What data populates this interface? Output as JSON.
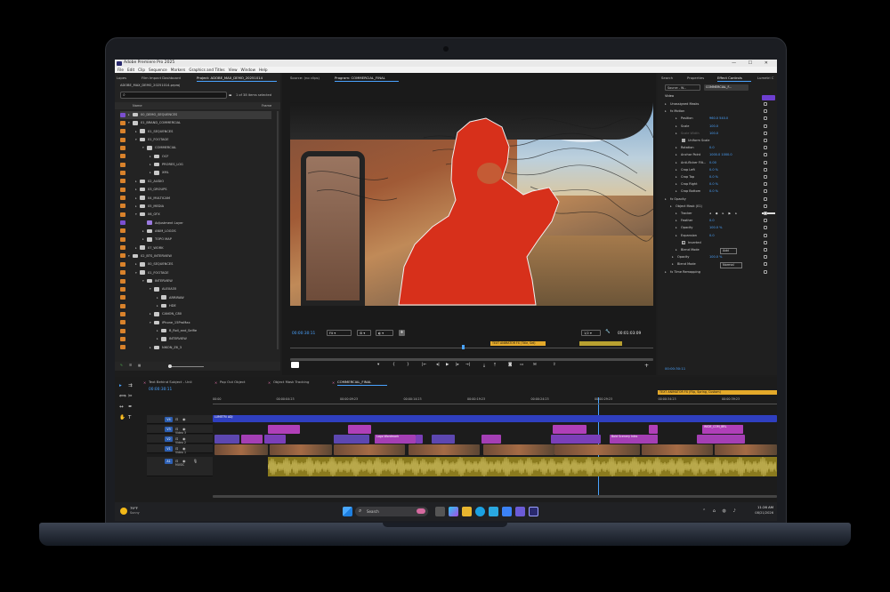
{
  "window": {
    "title": "Adobe Premiere Pro 2025",
    "menu": [
      "File",
      "Edit",
      "Clip",
      "Sequence",
      "Markers",
      "Graphics and Titles",
      "View",
      "Window",
      "Help"
    ]
  },
  "project_panel": {
    "tabs": [
      "Lopes",
      "Film Impact Dashboard",
      "Project: ADOBE_MAX_DEMO_20251014"
    ],
    "file": "ADOBE_MAX_DEMO_20251014.prproj",
    "count": "1 of 38 items selected",
    "col_name": "Name",
    "col_frame": "Frame",
    "items": [
      {
        "name": "00_DEMO_SEQUENCES",
        "depth": 0,
        "open": false,
        "color": "#7b4fd0",
        "type": "folder"
      },
      {
        "name": "01_BRAND_COMMERCIAL",
        "depth": 0,
        "open": true,
        "color": "#d9822b",
        "type": "folder"
      },
      {
        "name": "01_SEQUENCES",
        "depth": 1,
        "open": false,
        "color": "#d9822b",
        "type": "folder"
      },
      {
        "name": "01_FOOTAGE",
        "depth": 1,
        "open": true,
        "color": "#d9822b",
        "type": "folder"
      },
      {
        "name": "COMMERCIAL",
        "depth": 2,
        "open": true,
        "color": "#d9822b",
        "type": "folder"
      },
      {
        "name": "OCF",
        "depth": 3,
        "open": false,
        "color": "#d9822b",
        "type": "folder"
      },
      {
        "name": "PRORES_LOG",
        "depth": 3,
        "open": false,
        "color": "#d9822b",
        "type": "folder"
      },
      {
        "name": "XML",
        "depth": 3,
        "open": false,
        "color": "#d9822b",
        "type": "folder"
      },
      {
        "name": "02_AUDIO",
        "depth": 1,
        "open": false,
        "color": "#d9822b",
        "type": "folder"
      },
      {
        "name": "03_GROUPS",
        "depth": 1,
        "open": false,
        "color": "#d9822b",
        "type": "folder"
      },
      {
        "name": "04_MULTICAM",
        "depth": 1,
        "open": false,
        "color": "#d9822b",
        "type": "folder"
      },
      {
        "name": "05_MEDIA",
        "depth": 1,
        "open": false,
        "color": "#d9822b",
        "type": "folder"
      },
      {
        "name": "06_GFX",
        "depth": 1,
        "open": true,
        "color": "#d9822b",
        "type": "folder"
      },
      {
        "name": "Adjustment Layer",
        "depth": 2,
        "open": false,
        "color": "#7b4fd0",
        "type": "item"
      },
      {
        "name": "ANIM_LOGOS",
        "depth": 2,
        "open": false,
        "color": "#d9822b",
        "type": "folder"
      },
      {
        "name": "TOPO MAP",
        "depth": 2,
        "open": false,
        "color": "#d9822b",
        "type": "folder"
      },
      {
        "name": "07_WORK",
        "depth": 1,
        "open": false,
        "color": "#d9822b",
        "type": "folder"
      },
      {
        "name": "02_BTS_INTERVIEW",
        "depth": 0,
        "open": true,
        "color": "#d9822b",
        "type": "folder"
      },
      {
        "name": "00_SEQUENCES",
        "depth": 1,
        "open": false,
        "color": "#d9822b",
        "type": "folder"
      },
      {
        "name": "01_FOOTAGE",
        "depth": 1,
        "open": true,
        "color": "#d9822b",
        "type": "folder"
      },
      {
        "name": "INTERVIEW",
        "depth": 2,
        "open": true,
        "color": "#d9822b",
        "type": "folder"
      },
      {
        "name": "ALEXA35",
        "depth": 3,
        "open": true,
        "color": "#d9822b",
        "type": "folder"
      },
      {
        "name": "ARRIRAW",
        "depth": 4,
        "open": false,
        "color": "#d9822b",
        "type": "folder"
      },
      {
        "name": "HDE",
        "depth": 4,
        "open": false,
        "color": "#d9822b",
        "type": "folder"
      },
      {
        "name": "CANON_C80",
        "depth": 3,
        "open": false,
        "color": "#d9822b",
        "type": "folder"
      },
      {
        "name": "iPhone_15ProMax",
        "depth": 3,
        "open": true,
        "color": "#d9822b",
        "type": "folder"
      },
      {
        "name": "B_Roll_and_Selfie",
        "depth": 4,
        "open": false,
        "color": "#d9822b",
        "type": "folder"
      },
      {
        "name": "INTERVIEW",
        "depth": 4,
        "open": false,
        "color": "#d9822b",
        "type": "folder"
      },
      {
        "name": "NIKON_Z6_3",
        "depth": 3,
        "open": false,
        "color": "#d9822b",
        "type": "folder"
      }
    ]
  },
  "monitors": {
    "source_tab": "Source: (no clips)",
    "program_tab": "Program: COMMERCIAL_FINAL",
    "timecode_in": "00:00:30:11",
    "fit": "Fit",
    "fraction": "1/2",
    "timecode_out": "00:01:03:09",
    "marker_label": "TEXT ANIMATOR FX (Title, Set)"
  },
  "effect_controls": {
    "tabs": [
      "Search",
      "Properties",
      "Effect Controls",
      "Lumetri C"
    ],
    "source": "Source - W...",
    "clip": "COMMERCIAL_F...",
    "section": "Video",
    "rows": [
      {
        "label": "Unassigned Masks",
        "value": ""
      },
      {
        "label": "fx  Motion",
        "value": ""
      },
      {
        "label": "Position",
        "value": "960.0   540.0"
      },
      {
        "label": "Scale",
        "value": "100.0"
      },
      {
        "label": "Scale Width",
        "value": "100.0"
      },
      {
        "label": "Uniform Scale",
        "value": ""
      },
      {
        "label": "Rotation",
        "value": "0.0"
      },
      {
        "label": "Anchor Point",
        "value": "1000.0   1000.0"
      },
      {
        "label": "Anti-flicker Filt...",
        "value": "0.00"
      },
      {
        "label": "Crop Left",
        "value": "0.0 %"
      },
      {
        "label": "Crop Top",
        "value": "0.0 %"
      },
      {
        "label": "Crop Right",
        "value": "0.0 %"
      },
      {
        "label": "Crop Bottom",
        "value": "0.0 %"
      },
      {
        "label": "fx  Opacity",
        "value": ""
      },
      {
        "label": "Object Mask (01)",
        "value": ""
      },
      {
        "label": "Tracker",
        "value": ""
      },
      {
        "label": "Feather",
        "value": "0.0"
      },
      {
        "label": "Opacity",
        "value": "100.0 %"
      },
      {
        "label": "Expansion",
        "value": "0.0"
      },
      {
        "label": "Inverted",
        "value": ""
      },
      {
        "label": "Blend Mode",
        "value": "Add"
      },
      {
        "label": "Opacity",
        "value": "100.0 %"
      },
      {
        "label": "Blend Mode",
        "value": "Normal"
      },
      {
        "label": "fx  Time Remapping",
        "value": ""
      }
    ],
    "timecode": "00:00:30:11"
  },
  "timeline": {
    "tabs": [
      "Text Behind Subject - Unli",
      "Pop Out Object",
      "Object Mask Tracking",
      "COMMERCIAL_FINAL"
    ],
    "timecode": "00:00:30:11",
    "ruler": [
      "00:00",
      "00:00:04:23",
      "00:00:09:23",
      "00:00:14:23",
      "00:00:19:23",
      "00:00:24:23",
      "00:00:29:23",
      "00:00:34:23",
      "00:00:39:23"
    ],
    "marker_label": "TEXT ANIMATOR FX (Flip, Spring, Custom)",
    "tracks": [
      "V4",
      "V3",
      "V2",
      "V1",
      "A1"
    ],
    "track_names": [
      "Video 3",
      "Video 2",
      "Video 1",
      "MUSIC"
    ],
    "adjustment_clip": "LUMETRI ADJ",
    "clip_labels": [
      "WIDE_COM_BRL",
      "Fl: Shape Flow",
      "Logo Wordmark",
      "Fl: Flip Anim.",
      "TopoMap",
      "Fl: Shape Flow",
      "Fl: Flip Anim.",
      "Bold Scenery Intro",
      "Fl: Sh. Flip"
    ]
  },
  "taskbar": {
    "weather_temp": "79°F",
    "weather_desc": "Sunny",
    "search": "Search",
    "time": "11:26 AM",
    "date": "08/21/2026"
  }
}
